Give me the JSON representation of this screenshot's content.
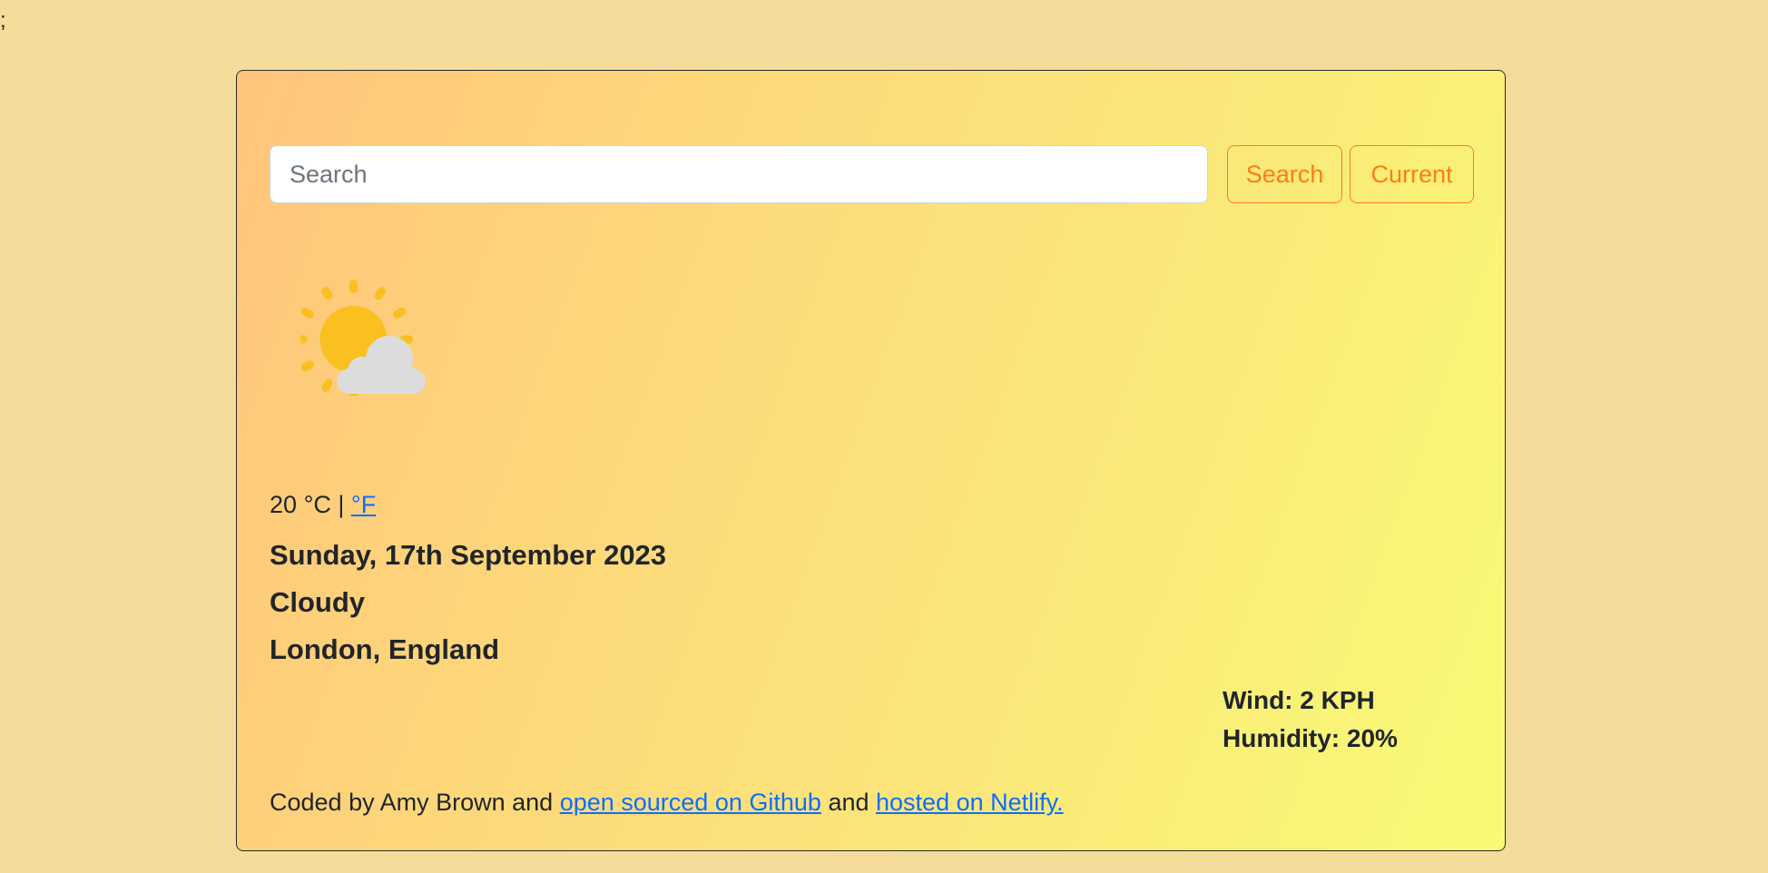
{
  "stray_text": ";",
  "search": {
    "placeholder": "Search",
    "value": "",
    "search_button_label": "Search",
    "current_button_label": "Current"
  },
  "weather": {
    "icon": "partly-cloudy-icon",
    "temperature": "20",
    "unit_celsius": "°C",
    "separator": "|",
    "unit_fahrenheit_link": "°F",
    "date": "Sunday, 17th September 2023",
    "description": "Cloudy",
    "location": "London, England",
    "wind": "Wind: 2 KPH",
    "humidity": "Humidity: 20%"
  },
  "footer": {
    "prefix": "Coded by Amy Brown and",
    "github_link": "open sourced on Github",
    "middle": "and",
    "netlify_link": "hosted on Netlify."
  },
  "colors": {
    "page_background": "#f4dc9a",
    "button_accent": "#fd7e14",
    "link": "#0d6efd",
    "sun": "#f9c020",
    "cloud": "#dcdcdc"
  }
}
